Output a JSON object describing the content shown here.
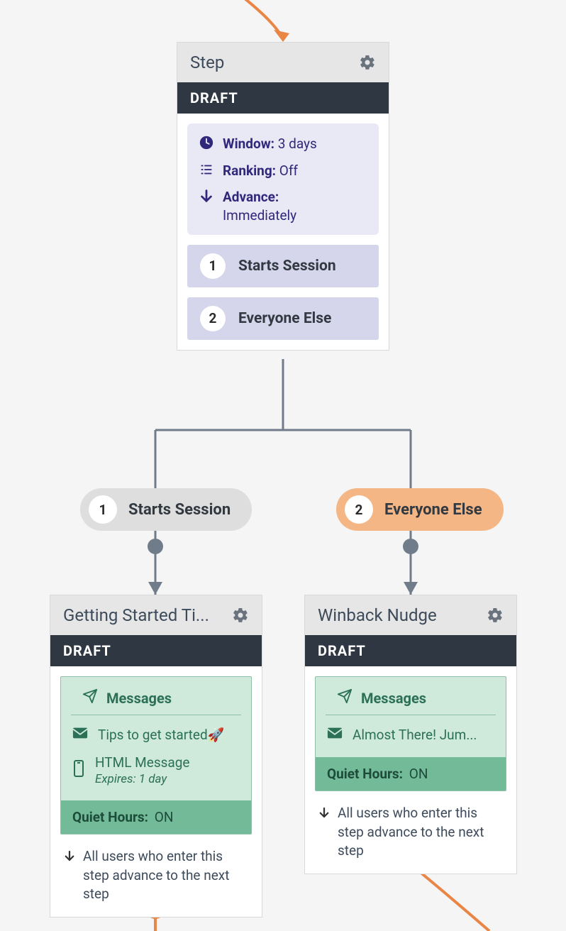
{
  "step": {
    "title": "Step",
    "status_label": "DRAFT",
    "window_label": "Window:",
    "window_value": "3 days",
    "ranking_label": "Ranking:",
    "ranking_value": "Off",
    "advance_label": "Advance:",
    "advance_value": "Immediately",
    "options": [
      {
        "num": "1",
        "label": "Starts Session"
      },
      {
        "num": "2",
        "label": "Everyone Else"
      }
    ]
  },
  "branches": [
    {
      "num": "1",
      "label": "Starts Session"
    },
    {
      "num": "2",
      "label": "Everyone Else"
    }
  ],
  "child_left": {
    "title": "Getting Started Ti...",
    "status_label": "DRAFT",
    "messages_label": "Messages",
    "items": [
      {
        "icon": "envelope",
        "label": "Tips to get started🚀"
      },
      {
        "icon": "phone",
        "label": "HTML Message",
        "sub": "Expires: 1 day"
      }
    ],
    "quiet_label": "Quiet Hours:",
    "quiet_value": "ON",
    "advance_note": "All users who enter this step advance to the next step"
  },
  "child_right": {
    "title": "Winback Nudge",
    "status_label": "DRAFT",
    "messages_label": "Messages",
    "items": [
      {
        "icon": "envelope",
        "label": "Almost There! Jum..."
      }
    ],
    "quiet_label": "Quiet Hours:",
    "quiet_value": "ON",
    "advance_note": "All users who enter this step advance to the next step"
  },
  "icons": {
    "gear": "gear-icon",
    "clock": "clock-icon",
    "ranking": "ranking-icon",
    "arrow_down": "arrow-down-icon",
    "paper_plane": "paper-plane-icon",
    "envelope": "envelope-icon",
    "phone": "phone-icon"
  },
  "colors": {
    "orange": "#e98545",
    "orange_fill": "#f5b685",
    "gray_line": "#717c8a",
    "indigo": "#31277b",
    "green_bar": "#73bb98"
  }
}
